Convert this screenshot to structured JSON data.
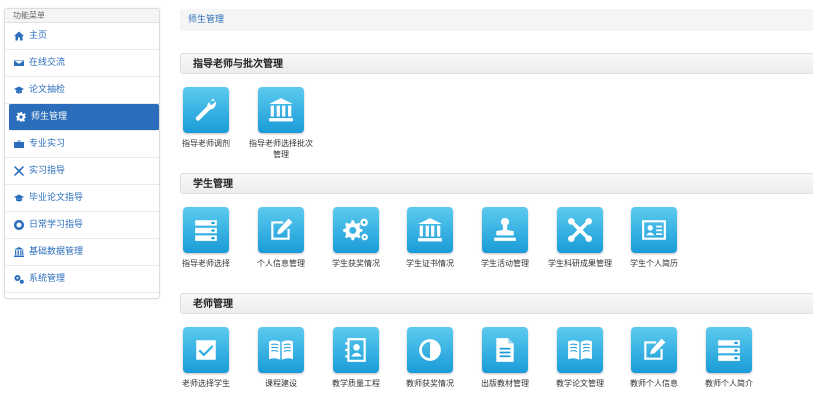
{
  "sidebar": {
    "header": "功能菜单",
    "items": [
      {
        "label": "主页",
        "icon": "home-icon"
      },
      {
        "label": "在线交流",
        "icon": "envelope-icon"
      },
      {
        "label": "论文抽检",
        "icon": "graduation-cap-icon"
      },
      {
        "label": "师生管理",
        "icon": "gear-icon",
        "active": true
      },
      {
        "label": "专业实习",
        "icon": "briefcase-icon"
      },
      {
        "label": "实习指导",
        "icon": "cross-tools-icon"
      },
      {
        "label": "毕业论文指导",
        "icon": "graduation-cap-icon"
      },
      {
        "label": "日常学习指导",
        "icon": "lifebuoy-icon"
      },
      {
        "label": "基础数据管理",
        "icon": "bank-icon"
      },
      {
        "label": "系统管理",
        "icon": "gears-icon"
      }
    ]
  },
  "breadcrumb": "师生管理",
  "sections": [
    {
      "title": "指导老师与批次管理",
      "tiles": [
        {
          "label": "指导老师调剂",
          "icon": "wrench-icon"
        },
        {
          "label": "指导老师选择批次管理",
          "icon": "bank-icon"
        }
      ]
    },
    {
      "title": "学生管理",
      "tiles": [
        {
          "label": "指导老师选择",
          "icon": "server-list-icon"
        },
        {
          "label": "个人信息管理",
          "icon": "edit-icon"
        },
        {
          "label": "学生获奖情况",
          "icon": "gears-icon"
        },
        {
          "label": "学生证书情况",
          "icon": "bank-icon"
        },
        {
          "label": "学生活动管理",
          "icon": "stamp-icon"
        },
        {
          "label": "学生科研成果管理",
          "icon": "cross-tools-icon"
        },
        {
          "label": "学生个人简历",
          "icon": "id-card-icon"
        }
      ]
    },
    {
      "title": "老师管理",
      "tiles": [
        {
          "label": "老师选择学生",
          "icon": "check-square-icon"
        },
        {
          "label": "课程建设",
          "icon": "open-book-icon"
        },
        {
          "label": "教学质量工程",
          "icon": "contact-book-icon"
        },
        {
          "label": "教师获奖情况",
          "icon": "contrast-icon"
        },
        {
          "label": "出版教材管理",
          "icon": "document-icon"
        },
        {
          "label": "教学论文管理",
          "icon": "open-book-icon"
        },
        {
          "label": "教师个人信息",
          "icon": "edit-icon"
        },
        {
          "label": "教师个人简介",
          "icon": "server-list-icon"
        }
      ]
    }
  ]
}
